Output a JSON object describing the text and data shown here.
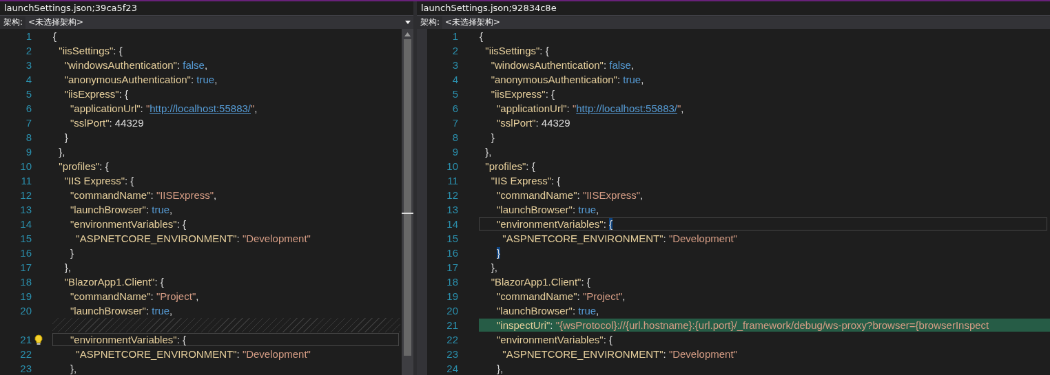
{
  "panes": [
    {
      "kind": "base",
      "title": "launchSettings.json;39ca5f23",
      "arch_label": "架构:",
      "arch_value": "<未选择架构>",
      "show_caret": true,
      "lines": [
        {
          "kind": "code",
          "number": "1",
          "tokens": [
            {
              "kind": "punct",
              "text": "{"
            }
          ]
        },
        {
          "kind": "code",
          "number": "2",
          "tokens": [
            {
              "kind": "key",
              "text": "  \"iisSettings\""
            },
            {
              "kind": "punct",
              "text": ": {"
            }
          ]
        },
        {
          "kind": "code",
          "number": "3",
          "tokens": [
            {
              "kind": "key",
              "text": "    \"windowsAuthentication\""
            },
            {
              "kind": "punct",
              "text": ": "
            },
            {
              "kind": "keyword",
              "text": "false"
            },
            {
              "kind": "punct",
              "text": ","
            }
          ]
        },
        {
          "kind": "code",
          "number": "4",
          "tokens": [
            {
              "kind": "key",
              "text": "    \"anonymousAuthentication\""
            },
            {
              "kind": "punct",
              "text": ": "
            },
            {
              "kind": "keyword",
              "text": "true"
            },
            {
              "kind": "punct",
              "text": ","
            }
          ]
        },
        {
          "kind": "code",
          "number": "5",
          "tokens": [
            {
              "kind": "key",
              "text": "    \"iisExpress\""
            },
            {
              "kind": "punct",
              "text": ": {"
            }
          ]
        },
        {
          "kind": "code",
          "number": "6",
          "tokens": [
            {
              "kind": "key",
              "text": "      \"applicationUrl\""
            },
            {
              "kind": "punct",
              "text": ": "
            },
            {
              "kind": "string",
              "text": "\""
            },
            {
              "kind": "link",
              "text": "http://localhost:55883/"
            },
            {
              "kind": "string",
              "text": "\""
            },
            {
              "kind": "punct",
              "text": ","
            }
          ]
        },
        {
          "kind": "code",
          "number": "7",
          "tokens": [
            {
              "kind": "key",
              "text": "      \"sslPort\""
            },
            {
              "kind": "punct",
              "text": ": "
            },
            {
              "kind": "number",
              "text": "44329"
            }
          ]
        },
        {
          "kind": "code",
          "number": "8",
          "tokens": [
            {
              "kind": "punct",
              "text": "    }"
            }
          ]
        },
        {
          "kind": "code",
          "number": "9",
          "tokens": [
            {
              "kind": "punct",
              "text": "  },"
            }
          ]
        },
        {
          "kind": "code",
          "number": "10",
          "tokens": [
            {
              "kind": "key",
              "text": "  \"profiles\""
            },
            {
              "kind": "punct",
              "text": ": {"
            }
          ]
        },
        {
          "kind": "code",
          "number": "11",
          "tokens": [
            {
              "kind": "key",
              "text": "    \"IIS Express\""
            },
            {
              "kind": "punct",
              "text": ": {"
            }
          ]
        },
        {
          "kind": "code",
          "number": "12",
          "tokens": [
            {
              "kind": "key",
              "text": "      \"commandName\""
            },
            {
              "kind": "punct",
              "text": ": "
            },
            {
              "kind": "string",
              "text": "\"IISExpress\""
            },
            {
              "kind": "punct",
              "text": ","
            }
          ]
        },
        {
          "kind": "code",
          "number": "13",
          "tokens": [
            {
              "kind": "key",
              "text": "      \"launchBrowser\""
            },
            {
              "kind": "punct",
              "text": ": "
            },
            {
              "kind": "keyword",
              "text": "true"
            },
            {
              "kind": "punct",
              "text": ","
            }
          ]
        },
        {
          "kind": "code",
          "number": "14",
          "tokens": [
            {
              "kind": "key",
              "text": "      \"environmentVariables\""
            },
            {
              "kind": "punct",
              "text": ": {"
            }
          ]
        },
        {
          "kind": "code",
          "number": "15",
          "tokens": [
            {
              "kind": "key",
              "text": "        \"ASPNETCORE_ENVIRONMENT\""
            },
            {
              "kind": "punct",
              "text": ": "
            },
            {
              "kind": "string",
              "text": "\"Development\""
            }
          ]
        },
        {
          "kind": "code",
          "number": "16",
          "tokens": [
            {
              "kind": "punct",
              "text": "      }"
            }
          ]
        },
        {
          "kind": "code",
          "number": "17",
          "tokens": [
            {
              "kind": "punct",
              "text": "    },"
            }
          ]
        },
        {
          "kind": "code",
          "number": "18",
          "tokens": [
            {
              "kind": "key",
              "text": "    \"BlazorApp1.Client\""
            },
            {
              "kind": "punct",
              "text": ": {"
            }
          ]
        },
        {
          "kind": "code",
          "number": "19",
          "tokens": [
            {
              "kind": "key",
              "text": "      \"commandName\""
            },
            {
              "kind": "punct",
              "text": ": "
            },
            {
              "kind": "string",
              "text": "\"Project\""
            },
            {
              "kind": "punct",
              "text": ","
            }
          ]
        },
        {
          "kind": "code",
          "number": "20",
          "tokens": [
            {
              "kind": "key",
              "text": "      \"launchBrowser\""
            },
            {
              "kind": "punct",
              "text": ": "
            },
            {
              "kind": "keyword",
              "text": "true"
            },
            {
              "kind": "punct",
              "text": ","
            }
          ]
        },
        {
          "kind": "gap"
        },
        {
          "kind": "hinted",
          "number": "21",
          "tokens": [
            {
              "kind": "key",
              "text": "      \"environmentVariables\""
            },
            {
              "kind": "punct",
              "text": ": {"
            }
          ]
        },
        {
          "kind": "code",
          "number": "22",
          "tokens": [
            {
              "kind": "key",
              "text": "        \"ASPNETCORE_ENVIRONMENT\""
            },
            {
              "kind": "punct",
              "text": ": "
            },
            {
              "kind": "string",
              "text": "\"Development\""
            }
          ]
        },
        {
          "kind": "code",
          "number": "23",
          "tokens": [
            {
              "kind": "punct",
              "text": "      },"
            }
          ]
        }
      ]
    },
    {
      "kind": "diff",
      "title": "launchSettings.json;92834c8e",
      "arch_label": "架构:",
      "arch_value": "<未选择架构>",
      "show_caret": false,
      "lines": [
        {
          "kind": "code",
          "number": "1",
          "tokens": [
            {
              "kind": "punct",
              "text": "{"
            }
          ]
        },
        {
          "kind": "code",
          "number": "2",
          "tokens": [
            {
              "kind": "key",
              "text": "  \"iisSettings\""
            },
            {
              "kind": "punct",
              "text": ": {"
            }
          ]
        },
        {
          "kind": "code",
          "number": "3",
          "tokens": [
            {
              "kind": "key",
              "text": "    \"windowsAuthentication\""
            },
            {
              "kind": "punct",
              "text": ": "
            },
            {
              "kind": "keyword",
              "text": "false"
            },
            {
              "kind": "punct",
              "text": ","
            }
          ]
        },
        {
          "kind": "code",
          "number": "4",
          "tokens": [
            {
              "kind": "key",
              "text": "    \"anonymousAuthentication\""
            },
            {
              "kind": "punct",
              "text": ": "
            },
            {
              "kind": "keyword",
              "text": "true"
            },
            {
              "kind": "punct",
              "text": ","
            }
          ]
        },
        {
          "kind": "code",
          "number": "5",
          "tokens": [
            {
              "kind": "key",
              "text": "    \"iisExpress\""
            },
            {
              "kind": "punct",
              "text": ": {"
            }
          ]
        },
        {
          "kind": "code",
          "number": "6",
          "tokens": [
            {
              "kind": "key",
              "text": "      \"applicationUrl\""
            },
            {
              "kind": "punct",
              "text": ": "
            },
            {
              "kind": "string",
              "text": "\""
            },
            {
              "kind": "link",
              "text": "http://localhost:55883/"
            },
            {
              "kind": "string",
              "text": "\""
            },
            {
              "kind": "punct",
              "text": ","
            }
          ]
        },
        {
          "kind": "code",
          "number": "7",
          "tokens": [
            {
              "kind": "key",
              "text": "      \"sslPort\""
            },
            {
              "kind": "punct",
              "text": ": "
            },
            {
              "kind": "number",
              "text": "44329"
            }
          ]
        },
        {
          "kind": "code",
          "number": "8",
          "tokens": [
            {
              "kind": "punct",
              "text": "    }"
            }
          ]
        },
        {
          "kind": "code",
          "number": "9",
          "tokens": [
            {
              "kind": "punct",
              "text": "  },"
            }
          ]
        },
        {
          "kind": "code",
          "number": "10",
          "tokens": [
            {
              "kind": "key",
              "text": "  \"profiles\""
            },
            {
              "kind": "punct",
              "text": ": {"
            }
          ]
        },
        {
          "kind": "code",
          "number": "11",
          "tokens": [
            {
              "kind": "key",
              "text": "    \"IIS Express\""
            },
            {
              "kind": "punct",
              "text": ": {"
            }
          ]
        },
        {
          "kind": "code",
          "number": "12",
          "tokens": [
            {
              "kind": "key",
              "text": "      \"commandName\""
            },
            {
              "kind": "punct",
              "text": ": "
            },
            {
              "kind": "string",
              "text": "\"IISExpress\""
            },
            {
              "kind": "punct",
              "text": ","
            }
          ]
        },
        {
          "kind": "code",
          "number": "13",
          "tokens": [
            {
              "kind": "key",
              "text": "      \"launchBrowser\""
            },
            {
              "kind": "punct",
              "text": ": "
            },
            {
              "kind": "keyword",
              "text": "true"
            },
            {
              "kind": "punct",
              "text": ","
            }
          ]
        },
        {
          "kind": "current",
          "number": "14",
          "tokens": [
            {
              "kind": "key",
              "text": "      \"environmentVariables\""
            },
            {
              "kind": "punct",
              "text": ": "
            },
            {
              "kind": "brace",
              "text": "{"
            }
          ]
        },
        {
          "kind": "code",
          "number": "15",
          "tokens": [
            {
              "kind": "key",
              "text": "        \"ASPNETCORE_ENVIRONMENT\""
            },
            {
              "kind": "punct",
              "text": ": "
            },
            {
              "kind": "string",
              "text": "\"Development\""
            }
          ]
        },
        {
          "kind": "code",
          "number": "16",
          "tokens": [
            {
              "kind": "brace",
              "text": "      }"
            }
          ]
        },
        {
          "kind": "code",
          "number": "17",
          "tokens": [
            {
              "kind": "punct",
              "text": "    },"
            }
          ]
        },
        {
          "kind": "code",
          "number": "18",
          "tokens": [
            {
              "kind": "key",
              "text": "    \"BlazorApp1.Client\""
            },
            {
              "kind": "punct",
              "text": ": {"
            }
          ]
        },
        {
          "kind": "code",
          "number": "19",
          "tokens": [
            {
              "kind": "key",
              "text": "      \"commandName\""
            },
            {
              "kind": "punct",
              "text": ": "
            },
            {
              "kind": "string",
              "text": "\"Project\""
            },
            {
              "kind": "punct",
              "text": ","
            }
          ]
        },
        {
          "kind": "code",
          "number": "20",
          "tokens": [
            {
              "kind": "key",
              "text": "      \"launchBrowser\""
            },
            {
              "kind": "punct",
              "text": ": "
            },
            {
              "kind": "keyword",
              "text": "true"
            },
            {
              "kind": "punct",
              "text": ","
            }
          ]
        },
        {
          "kind": "added",
          "number": "21",
          "tokens": [
            {
              "kind": "key",
              "text": "      \"inspectUri\""
            },
            {
              "kind": "punct",
              "text": ": "
            },
            {
              "kind": "string",
              "text": "\"{wsProtocol}://{url.hostname}:{url.port}/_framework/debug/ws-proxy?browser={browserInspect"
            }
          ]
        },
        {
          "kind": "code",
          "number": "22",
          "tokens": [
            {
              "kind": "key",
              "text": "      \"environmentVariables\""
            },
            {
              "kind": "punct",
              "text": ": {"
            }
          ]
        },
        {
          "kind": "code",
          "number": "23",
          "tokens": [
            {
              "kind": "key",
              "text": "        \"ASPNETCORE_ENVIRONMENT\""
            },
            {
              "kind": "punct",
              "text": ": "
            },
            {
              "kind": "string",
              "text": "\"Development\""
            }
          ]
        },
        {
          "kind": "code",
          "number": "24",
          "tokens": [
            {
              "kind": "punct",
              "text": "      },"
            }
          ]
        }
      ]
    }
  ]
}
